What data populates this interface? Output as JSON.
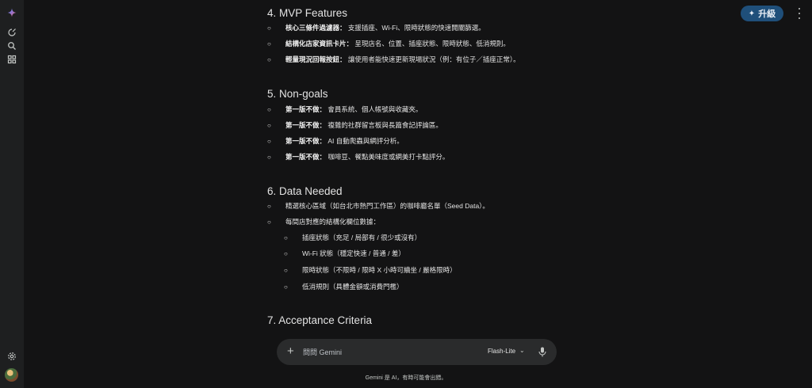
{
  "header": {
    "upgrade_label": "升級"
  },
  "sections": {
    "mvp": {
      "title": "4. MVP Features",
      "items": [
        {
          "label": "核心三條件過濾器：",
          "text": "支援插座、Wi-Fi、限時狀態的快速開關篩選。"
        },
        {
          "label": "結構化店家資訊卡片：",
          "text": "呈現店名、位置、插座狀態、限時狀態、低消規則。"
        },
        {
          "label": "輕量現況回報按鈕：",
          "text": "讓使用者能快速更新現場狀況（例：有位子／插座正常）。"
        }
      ]
    },
    "nongoals": {
      "title": "5. Non-goals",
      "items": [
        {
          "label": "第一版不做：",
          "text": "會員系統、個人帳號與收藏夾。"
        },
        {
          "label": "第一版不做：",
          "text": "複雜的社群留言板與長篇食記評論區。"
        },
        {
          "label": "第一版不做：",
          "text": "AI 自動爬蟲與網評分析。"
        },
        {
          "label": "第一版不做：",
          "text": "咖啡豆、餐點美味度或網美打卡點評分。"
        }
      ]
    },
    "data": {
      "title": "6. Data Needed",
      "items": [
        "精選核心區域（如台北市熱門工作區）的咖啡廳名單（Seed Data）。",
        "每間店對應的結構化欄位數據："
      ],
      "subitems": [
        "插座狀態（充足 / 局部有 / 很少或沒有）",
        "Wi-Fi 狀態（穩定快速 / 普通 / 差）",
        "限時狀態（不限時 / 限時 X 小時可續坐 / 嚴格限時）",
        "低消規則（具體金額或消費門檻）"
      ]
    },
    "acceptance": {
      "title": "7. Acceptance Criteria"
    }
  },
  "bullet_char": "○",
  "composer": {
    "placeholder": "問問 Gemini",
    "model": "Flash-Lite"
  },
  "footer": "Gemini 是 AI，有時可能會出錯。"
}
